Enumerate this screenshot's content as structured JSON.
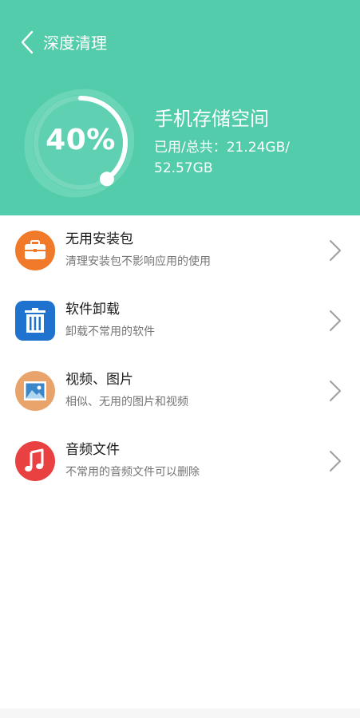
{
  "header": {
    "title": "深度清理",
    "background_color": "#52ccab",
    "back_icon": "chevron-left-icon"
  },
  "storage": {
    "percent_label": "40%",
    "percent_value": 0.4,
    "title": "手机存储空间",
    "usage_line1": "已用/总共：21.24GB/",
    "usage_line2": "52.57GB"
  },
  "items": [
    {
      "title": "无用安装包",
      "desc": "清理安装包不影响应用的使用",
      "icon": "briefcase-icon",
      "color": "#f07a2a"
    },
    {
      "title": "软件卸载",
      "desc": "卸载不常用的软件",
      "icon": "trash-icon",
      "color": "#1f73cf"
    },
    {
      "title": "视频、图片",
      "desc": "相似、无用的图片和视频",
      "icon": "image-icon",
      "color": "#e9a46c"
    },
    {
      "title": "音频文件",
      "desc": "不常用的音频文件可以删除",
      "icon": "music-note-icon",
      "color": "#e94141"
    }
  ]
}
